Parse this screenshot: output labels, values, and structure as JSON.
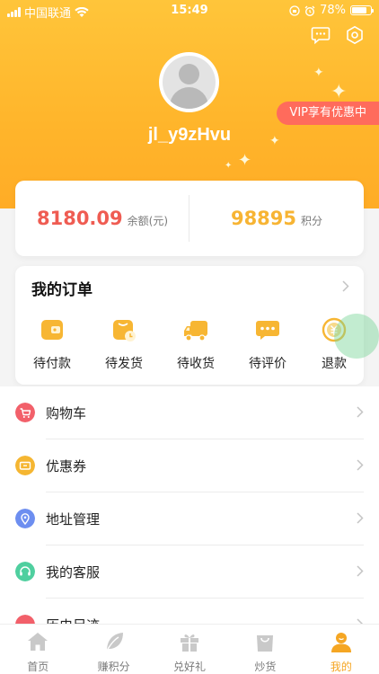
{
  "status_bar": {
    "carrier": "中国联通",
    "time": "15:49",
    "battery": "78%",
    "battery_level": 0.78
  },
  "profile": {
    "username": "jl_y9zHvu",
    "vip_badge": "VIP享有优惠中"
  },
  "balance": {
    "amount": "8180.09",
    "amount_unit": "余额(元)",
    "points": "98895",
    "points_unit": "积分"
  },
  "orders": {
    "title": "我的订单",
    "items": [
      {
        "label": "待付款",
        "icon": "wallet-icon"
      },
      {
        "label": "待发货",
        "icon": "pending-shipment-icon"
      },
      {
        "label": "待收货",
        "icon": "delivery-truck-icon"
      },
      {
        "label": "待评价",
        "icon": "review-chat-icon"
      },
      {
        "label": "退款",
        "icon": "refund-coin-icon"
      }
    ]
  },
  "menu": [
    {
      "label": "购物车",
      "icon": "cart-icon",
      "color": "#f2606a"
    },
    {
      "label": "优惠券",
      "icon": "coupon-icon",
      "color": "#f5b632"
    },
    {
      "label": "地址管理",
      "icon": "location-icon",
      "color": "#6d8ef0"
    },
    {
      "label": "我的客服",
      "icon": "headset-icon",
      "color": "#4fcf9f"
    },
    {
      "label": "历史足迹",
      "icon": "history-icon",
      "color": "#f2606a"
    }
  ],
  "tabbar": [
    {
      "label": "首页",
      "icon": "home-icon"
    },
    {
      "label": "赚积分",
      "icon": "leaf-icon"
    },
    {
      "label": "兑好礼",
      "icon": "gift-icon"
    },
    {
      "label": "炒货",
      "icon": "shopping-bag-icon"
    },
    {
      "label": "我的",
      "icon": "profile-icon"
    }
  ],
  "colors": {
    "brand": "#ffb52b",
    "balance_red": "#ef5c52",
    "points_orange": "#f7b433",
    "active_tab": "#f5a623"
  }
}
